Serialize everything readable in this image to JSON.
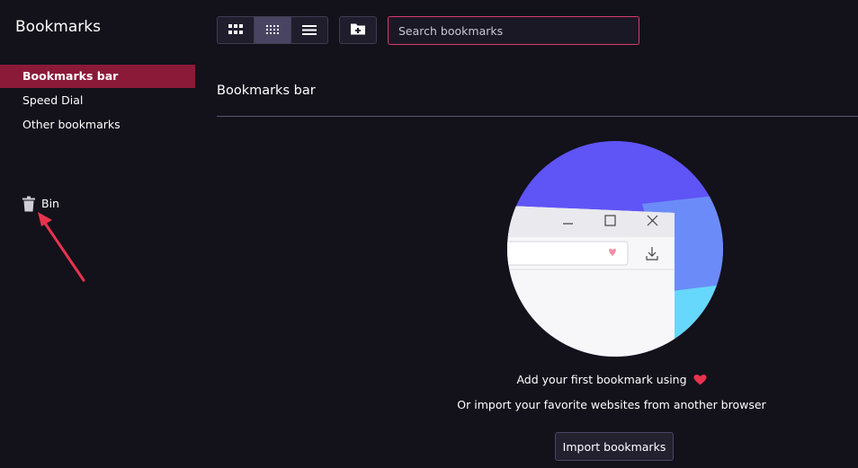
{
  "sidebar": {
    "title": "Bookmarks",
    "items": [
      {
        "label": "Bookmarks bar",
        "active": true
      },
      {
        "label": "Speed Dial",
        "active": false
      },
      {
        "label": "Other bookmarks",
        "active": false
      }
    ],
    "bin_label": "Bin",
    "bin_icon": "trash-icon",
    "annotation": "red-arrow pointing to Bin"
  },
  "toolbar": {
    "view_buttons": [
      {
        "name": "large-tiles-view",
        "icon": "grid-large-icon",
        "active": false
      },
      {
        "name": "small-tiles-view",
        "icon": "grid-small-icon",
        "active": true
      },
      {
        "name": "list-view",
        "icon": "list-icon",
        "active": false
      }
    ],
    "new_folder_icon": "folder-plus-icon",
    "search": {
      "value": "",
      "placeholder": "Search bookmarks"
    }
  },
  "main": {
    "section_title": "Bookmarks bar",
    "empty_state": {
      "line1": "Add your first bookmark using",
      "line1_icon": "heart-icon",
      "line2": "Or import your favorite websites from another browser",
      "import_button": "Import bookmarks"
    }
  },
  "colors": {
    "background": "#13111a",
    "accent": "#8b1a38",
    "search_border": "#d63a6e",
    "heart": "#e8334f"
  }
}
